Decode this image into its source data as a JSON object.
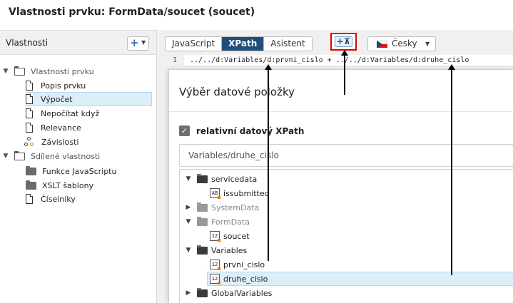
{
  "window": {
    "title": "Vlastnosti prvku: FormData/soucet (soucet)"
  },
  "left_panel": {
    "header": "Vlastnosti",
    "add_label": "+",
    "groups": [
      {
        "label": "Vlastnosti prvku",
        "items": [
          "Popis prvku",
          "Výpočet",
          "Nepočítat když",
          "Relevance",
          "Závislosti"
        ]
      },
      {
        "label": "Sdílené vlastnosti",
        "items": [
          "Funkce JavaScriptu",
          "XSLT šablony",
          "Číselníky"
        ]
      }
    ],
    "selected_item": "Výpočet"
  },
  "tabs": [
    "JavaScript",
    "XPath",
    "Asistent"
  ],
  "active_tab": "XPath",
  "insert_button": {
    "icon": "insert-data-icon",
    "label": "+⊼"
  },
  "language": {
    "label": "Česky",
    "flag": "cz-flag-icon"
  },
  "editor": {
    "line_number": "1",
    "code": "../../d:Variables/d:prvni_cislo + ../../d:Variables/d:druhe_cislo"
  },
  "dialog": {
    "title": "Výběr datové položky",
    "checkbox_label": "relativní datový XPath",
    "checkbox_checked": true,
    "search_value": "Variables/druhe_cislo",
    "tree": [
      {
        "label": "servicedata",
        "type": "folder"
      },
      {
        "label": "issubmitted",
        "type": "text",
        "badge": "AB"
      },
      {
        "label": "SystemData",
        "type": "folder"
      },
      {
        "label": "FormData",
        "type": "folder"
      },
      {
        "label": "soucet",
        "type": "number",
        "badge": "12"
      },
      {
        "label": "Variables",
        "type": "folder"
      },
      {
        "label": "prvni_cislo",
        "type": "number",
        "badge": "12"
      },
      {
        "label": "druhe_cislo",
        "type": "number",
        "badge": "12"
      },
      {
        "label": "GlobalVariables",
        "type": "folder"
      }
    ],
    "selected": "druhe_cislo"
  },
  "colors": {
    "accent": "#1f4e79",
    "highlight": "#e00000",
    "selection": "#dceefa"
  }
}
